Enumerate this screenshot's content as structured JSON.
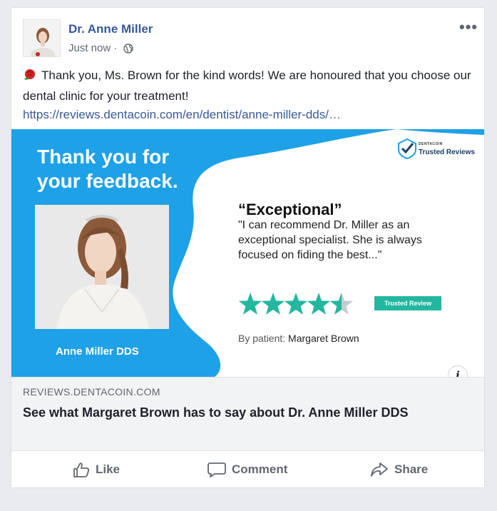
{
  "post": {
    "author": "Dr. Anne Miller",
    "timestamp": "Just now",
    "separator": "·",
    "privacy_icon": "globe-icon",
    "more_label": "•••",
    "emoji": "rose-emoji",
    "text": "Thank you, Ms. Brown for the kind words! We are honoured that you choose our dental clinic for your treatment!",
    "link_text": "https://reviews.dentacoin.com/en/dentist/anne-miller-dds/…"
  },
  "hero": {
    "heading_line1": "Thank you for",
    "heading_line2": "your feedback.",
    "photo_caption": "Anne Miller DDS",
    "logo_small": "DENTACOIN",
    "logo_text": "Trusted Reviews",
    "quote_title": "“Exceptional”",
    "quote_body": "\"I can recommend Dr. Miller as an exceptional specialist. She is always focused on fiding the best...\"",
    "rating": 4.5,
    "rating_max": 5,
    "badge": "Trusted Review",
    "by_label": "By patient:",
    "patient_name": "Margaret Brown",
    "info_label": "i"
  },
  "link_preview": {
    "domain": "REVIEWS.DENTACOIN.COM",
    "title": "See what Margaret Brown has to say about Dr. Anne Miller DDS"
  },
  "actions": {
    "like": "Like",
    "comment": "Comment",
    "share": "Share"
  },
  "colors": {
    "brand_blue": "#1ea1e6",
    "star_teal": "#23b7a0",
    "link": "#385898",
    "author": "#365899"
  }
}
